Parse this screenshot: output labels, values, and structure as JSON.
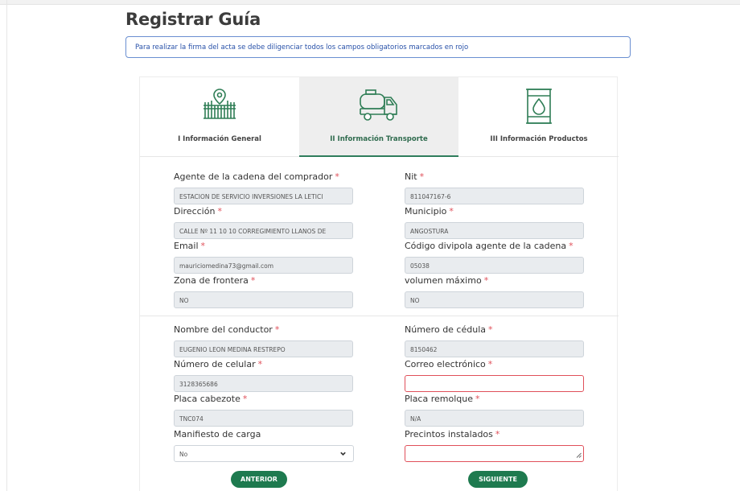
{
  "page": {
    "title": "Registrar Guía"
  },
  "notice": {
    "text": "Para realizar la firma del acta se debe diligenciar todos los campos obligatorios marcados en rojo"
  },
  "tabs": [
    {
      "label": "I Información General",
      "icon": "fence-location-icon",
      "active": false
    },
    {
      "label": "II Información Transporte",
      "icon": "tanker-truck-icon",
      "active": true
    },
    {
      "label": "III Información Productos",
      "icon": "oil-barrel-icon",
      "active": false
    }
  ],
  "accent_color": "#1e7a4f",
  "required_color": "#e0505a",
  "required_mark": "*",
  "fields": {
    "agente": {
      "label": "Agente de la cadena del comprador",
      "value": "ESTACION DE SERVICIO INVERSIONES LA LETICI"
    },
    "nit": {
      "label": "Nit",
      "value": "811047167-6"
    },
    "direccion": {
      "label": "Dirección",
      "value": "CALLE Nº 11 10 10 CORREGIMIENTO LLANOS DE"
    },
    "municipio": {
      "label": "Municipio",
      "value": "ANGOSTURA"
    },
    "email": {
      "label": "Email",
      "value": "mauriciomedina73@gmail.com"
    },
    "divipola": {
      "label": "Código divipola agente de la cadena",
      "value": "05038"
    },
    "zona_frontera": {
      "label": "Zona de frontera",
      "value": "NO"
    },
    "volumen_maximo": {
      "label": "volumen máximo",
      "value": "NO"
    },
    "conductor": {
      "label": "Nombre del conductor",
      "value": "EUGENIO LEON MEDINA RESTREPO"
    },
    "cedula": {
      "label": "Número de cédula",
      "value": "8150462"
    },
    "celular": {
      "label": "Número de celular",
      "value": "3128365686"
    },
    "correo": {
      "label": "Correo electrónico",
      "value": ""
    },
    "placa_cabezote": {
      "label": "Placa cabezote",
      "value": "TNC074"
    },
    "placa_remolque": {
      "label": "Placa remolque",
      "value": "N/A"
    },
    "manifiesto": {
      "label": "Manifiesto de carga",
      "value": "No"
    },
    "precintos": {
      "label": "Precintos instalados",
      "value": ""
    }
  },
  "buttons": {
    "prev": "ANTERIOR",
    "next": "SIGUIENTE"
  }
}
